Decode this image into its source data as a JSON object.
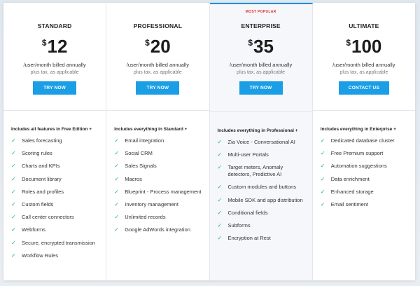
{
  "plans": [
    {
      "name": "STANDARD",
      "currency": "$",
      "price": "12",
      "billed": "/user/month billed annually",
      "tax": "plus tax, as applicable",
      "button": "TRY NOW",
      "features_header": "Includes all features in Free Edition +",
      "features": [
        "Sales forecasting",
        "Scoring rules",
        "Charts and KPIs",
        "Document library",
        "Roles and profiles",
        "Custom fields",
        "Call center connectors",
        "Webforms",
        "Secure, encrypted transmission",
        "Workflow Rules"
      ]
    },
    {
      "name": "PROFESSIONAL",
      "currency": "$",
      "price": "20",
      "billed": "/user/month billed annually",
      "tax": "plus tax, as applicable",
      "button": "TRY NOW",
      "features_header": "Includes everything in Standard +",
      "features": [
        "Email integration",
        "Social CRM",
        "Sales Signals",
        "Macros",
        "Blueprint - Process management",
        "Inventory management",
        "Unlimited records",
        "Google AdWords integration"
      ]
    },
    {
      "badge": "MOST POPULAR",
      "name": "ENTERPRISE",
      "currency": "$",
      "price": "35",
      "billed": "/user/month billed annually",
      "tax": "plus tax, as applicable",
      "button": "TRY NOW",
      "features_header": "Includes everything in Professional +",
      "features": [
        "Zia Voice - Conversational AI",
        "Multi-user Portals",
        "Target meters, Anomaly detectors, Predictive AI",
        "Custom modules and buttons",
        "Mobile SDK and app distribution",
        "Conditional fields",
        "Subforms",
        "Encryption at Rest"
      ]
    },
    {
      "name": "ULTIMATE",
      "currency": "$",
      "price": "100",
      "billed": "/user/month billed annually",
      "tax": "plus tax, as applicable",
      "button": "CONTACT US",
      "features_header": "Includes everything in Enterprise +",
      "features": [
        "Dedicated database cluster",
        "Free Premium support",
        "Automation suggestions",
        "Data enrichment",
        "Enhanced storage",
        "Email sentiment"
      ]
    }
  ],
  "colors": {
    "accent": "#1a9ee6",
    "badge": "#e03131",
    "check": "#16b58a"
  },
  "icons": {
    "check": "check-icon"
  }
}
